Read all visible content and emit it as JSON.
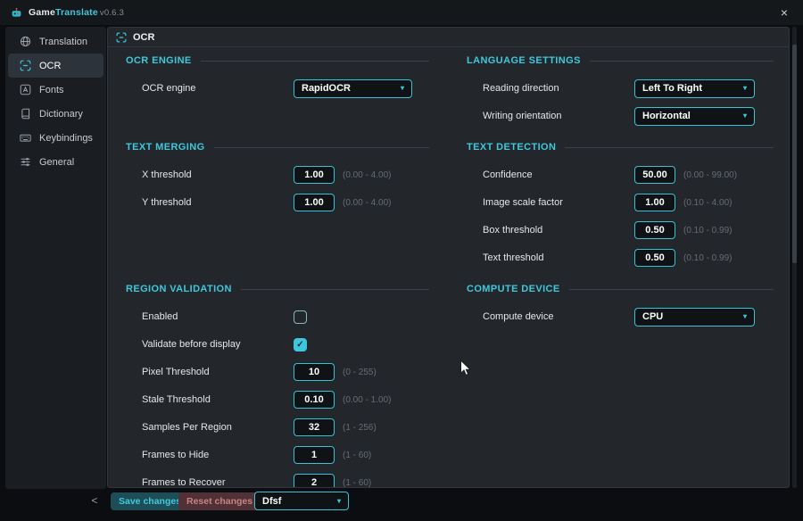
{
  "titlebar": {
    "app_name_primary": "Game",
    "app_name_accent": "Translate",
    "version": "v0.6.3"
  },
  "icons": {
    "close": "×",
    "caret": "▾",
    "check": "✓",
    "collapse": "<"
  },
  "sidebar": {
    "items": [
      {
        "label": "Translation",
        "selected": false
      },
      {
        "label": "OCR",
        "selected": true
      },
      {
        "label": "Fonts",
        "selected": false
      },
      {
        "label": "Dictionary",
        "selected": false
      },
      {
        "label": "Keybindings",
        "selected": false
      },
      {
        "label": "General",
        "selected": false
      }
    ]
  },
  "panel": {
    "title": "OCR"
  },
  "sections": {
    "ocr_engine": {
      "heading": "OCR ENGINE",
      "engine_label": "OCR engine",
      "engine_value": "RapidOCR"
    },
    "text_merging": {
      "heading": "TEXT MERGING",
      "rows": [
        {
          "label": "X threshold",
          "value": "1.00",
          "hint": "(0.00 - 4.00)"
        },
        {
          "label": "Y threshold",
          "value": "1.00",
          "hint": "(0.00 - 4.00)"
        }
      ]
    },
    "region_validation": {
      "heading": "REGION VALIDATION",
      "toggles": [
        {
          "label": "Enabled",
          "checked": false
        },
        {
          "label": "Validate before display",
          "checked": true
        }
      ],
      "rows": [
        {
          "label": "Pixel Threshold",
          "value": "10",
          "hint": "(0 - 255)"
        },
        {
          "label": "Stale Threshold",
          "value": "0.10",
          "hint": "(0.00 - 1.00)"
        },
        {
          "label": "Samples Per Region",
          "value": "32",
          "hint": "(1 - 256)"
        },
        {
          "label": "Frames to Hide",
          "value": "1",
          "hint": "(1 - 60)"
        },
        {
          "label": "Frames to Recover",
          "value": "2",
          "hint": "(1 - 60)"
        }
      ]
    },
    "language_settings": {
      "heading": "LANGUAGE SETTINGS",
      "rows": [
        {
          "label": "Reading direction",
          "value": "Left To Right"
        },
        {
          "label": "Writing orientation",
          "value": "Horizontal"
        }
      ]
    },
    "text_detection": {
      "heading": "TEXT DETECTION",
      "rows": [
        {
          "label": "Confidence",
          "value": "50.00",
          "hint": "(0.00 - 99.00)"
        },
        {
          "label": "Image scale factor",
          "value": "1.00",
          "hint": "(0.10 - 4.00)"
        },
        {
          "label": "Box threshold",
          "value": "0.50",
          "hint": "(0.10 - 0.99)"
        },
        {
          "label": "Text threshold",
          "value": "0.50",
          "hint": "(0.10 - 0.99)"
        }
      ]
    },
    "compute_device": {
      "heading": "COMPUTE DEVICE",
      "device_label": "Compute device",
      "device_value": "CPU"
    }
  },
  "footer": {
    "save_label": "Save changes",
    "reset_label": "Reset changes",
    "dropdown_value": "Dfsf"
  },
  "colors": {
    "accent": "#3ec6dc",
    "danger": "#c98383",
    "panel_bg": "#23272c"
  }
}
